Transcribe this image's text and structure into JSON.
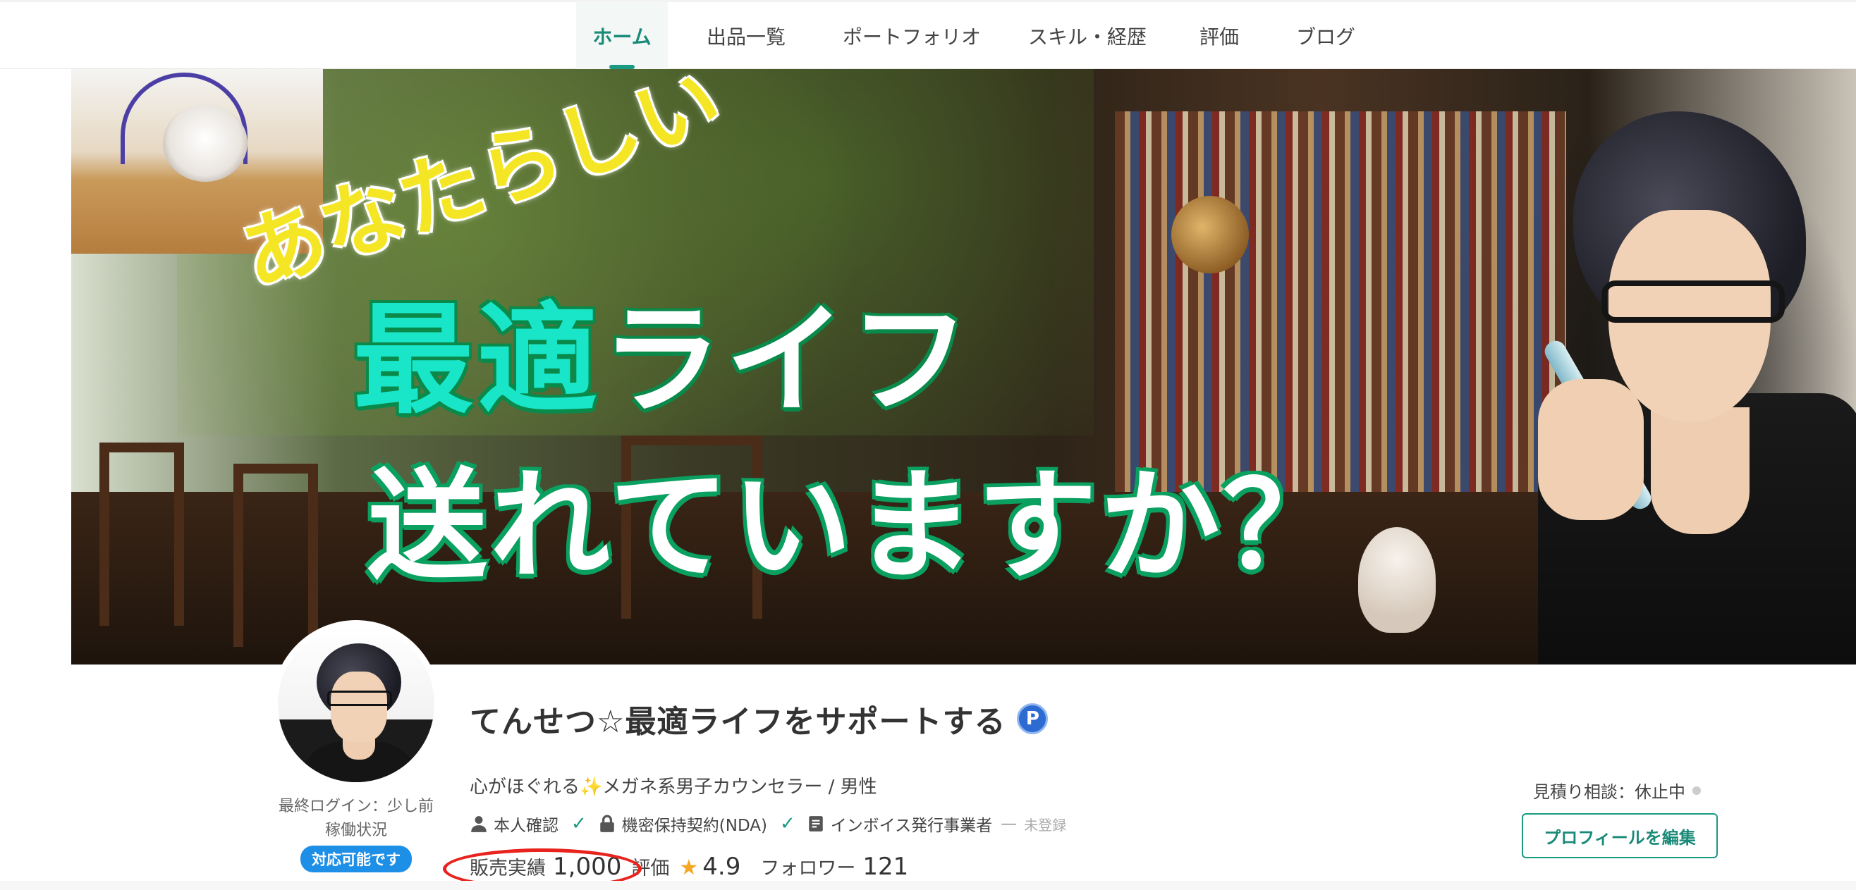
{
  "nav": {
    "tabs": [
      {
        "label": "ホーム",
        "active": true
      },
      {
        "label": "出品一覧",
        "active": false
      },
      {
        "label": "ポートフォリオ",
        "active": false
      },
      {
        "label": "スキル・経歴",
        "active": false
      },
      {
        "label": "評価",
        "active": false
      },
      {
        "label": "ブログ",
        "active": false
      }
    ]
  },
  "banner": {
    "line_yellow": "あなたらしい",
    "line_main1_a": "最適",
    "line_main1_b": "ライフ",
    "line_main2": "送れていますか？"
  },
  "profile": {
    "display_name": "てんせつ☆最適ライフをサポートする",
    "badge_letter": "P",
    "tagline_prefix": "心がほぐれる",
    "tagline_sparkle": "✨",
    "tagline_suffix": "メガネ系男子カウンセラー / 男性",
    "last_login": "最終ログイン：少し前",
    "status_label": "稼働状況",
    "availability": "対応可能です",
    "verifications": {
      "identity": "本人確認",
      "nda": "機密保持契約(NDA)",
      "invoice": "インボイス発行事業者",
      "invoice_dash": "—",
      "invoice_status": "未登録"
    },
    "stats": {
      "sales_label": "販売実績",
      "sales_value": "1,000",
      "rating_label": "評価",
      "rating_value": "4.9",
      "followers_label": "フォロワー",
      "followers_value": "121"
    }
  },
  "sidebar": {
    "quote_status": "見積り相談：休止中",
    "edit_button": "プロフィールを編集"
  },
  "colors": {
    "accent": "#1a9a82",
    "availability_badge": "#1e8fe6",
    "annotation_circle": "#e8231d",
    "rating_star": "#f5a623"
  }
}
